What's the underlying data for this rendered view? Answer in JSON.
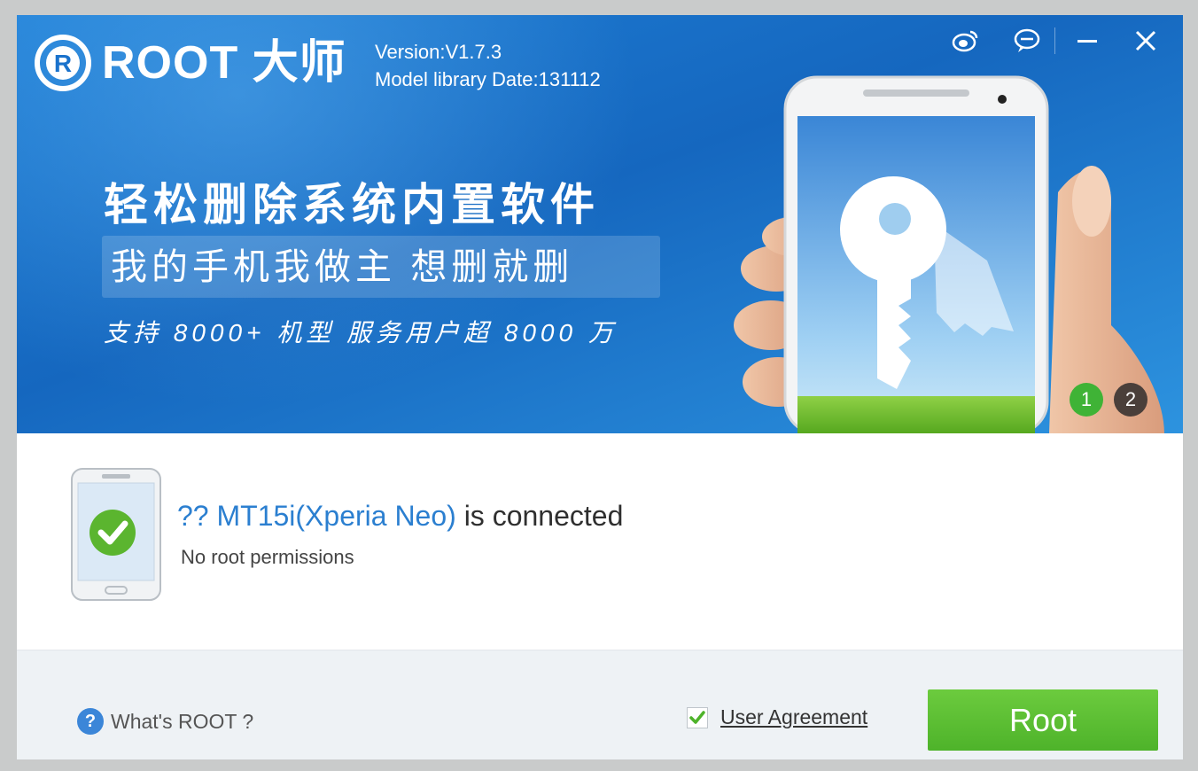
{
  "app": {
    "name": "ROOT 大师",
    "version": "Version:V1.7.3",
    "model_library": "Model library Date:131112"
  },
  "window_controls": {
    "icons": [
      "weibo-icon",
      "chat-icon",
      "minimize-icon",
      "close-icon"
    ]
  },
  "banner": {
    "headline": "轻松删除系统内置软件",
    "slogan": "我的手机我做主  想删就删",
    "support": "支持 8000+ 机型  服务用户超 8000 万",
    "slides": [
      "1",
      "2"
    ],
    "active_slide": "1"
  },
  "device": {
    "prefix": "??",
    "model": "MT15i(Xperia Neo)",
    "suffix": "is connected",
    "status": "No root permissions"
  },
  "footer": {
    "help_link": "What's ROOT ?",
    "agreement_label": "User Agreement",
    "agreement_checked": true,
    "root_button": "Root"
  },
  "colors": {
    "banner_blue": "#1a72cc",
    "accent_green": "#5cbf33",
    "link_blue": "#2b7fd0"
  }
}
